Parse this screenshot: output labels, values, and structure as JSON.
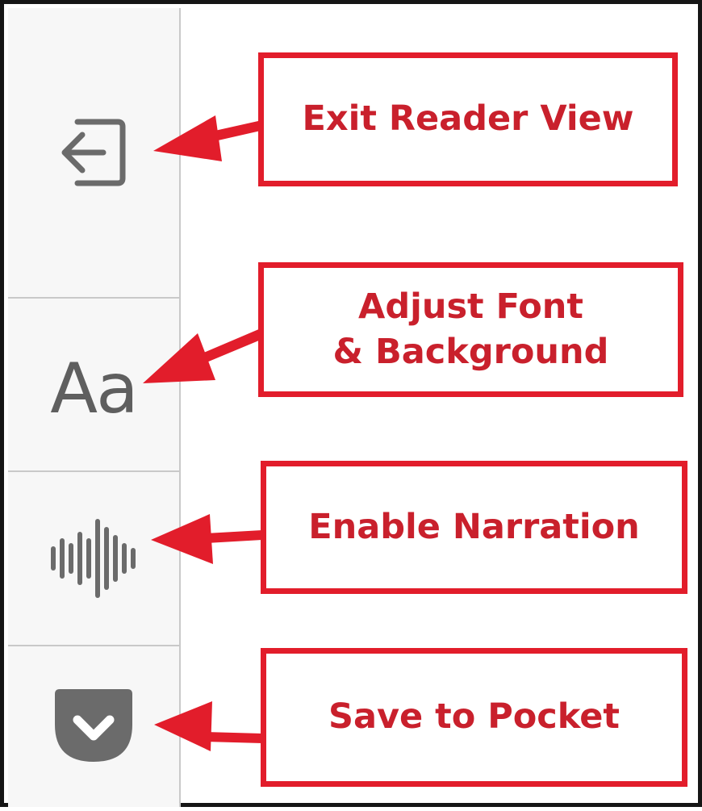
{
  "toolbar": {
    "exit_icon": "exit-reader-icon",
    "font_glyph": "Aa",
    "narrate_icon": "narration-waveform-icon",
    "pocket_icon": "pocket-save-icon"
  },
  "callouts": {
    "exit": "Exit Reader View",
    "font_line1": "Adjust Font",
    "font_line2": "& Background",
    "narrate": "Enable Narration",
    "pocket": "Save to Pocket"
  },
  "colors": {
    "annotation_red": "#e21d2b",
    "annotation_text": "#c9202c",
    "icon_gray": "#6b6b6b",
    "toolbar_bg": "#f7f7f7",
    "separator": "#c9c9c9"
  }
}
